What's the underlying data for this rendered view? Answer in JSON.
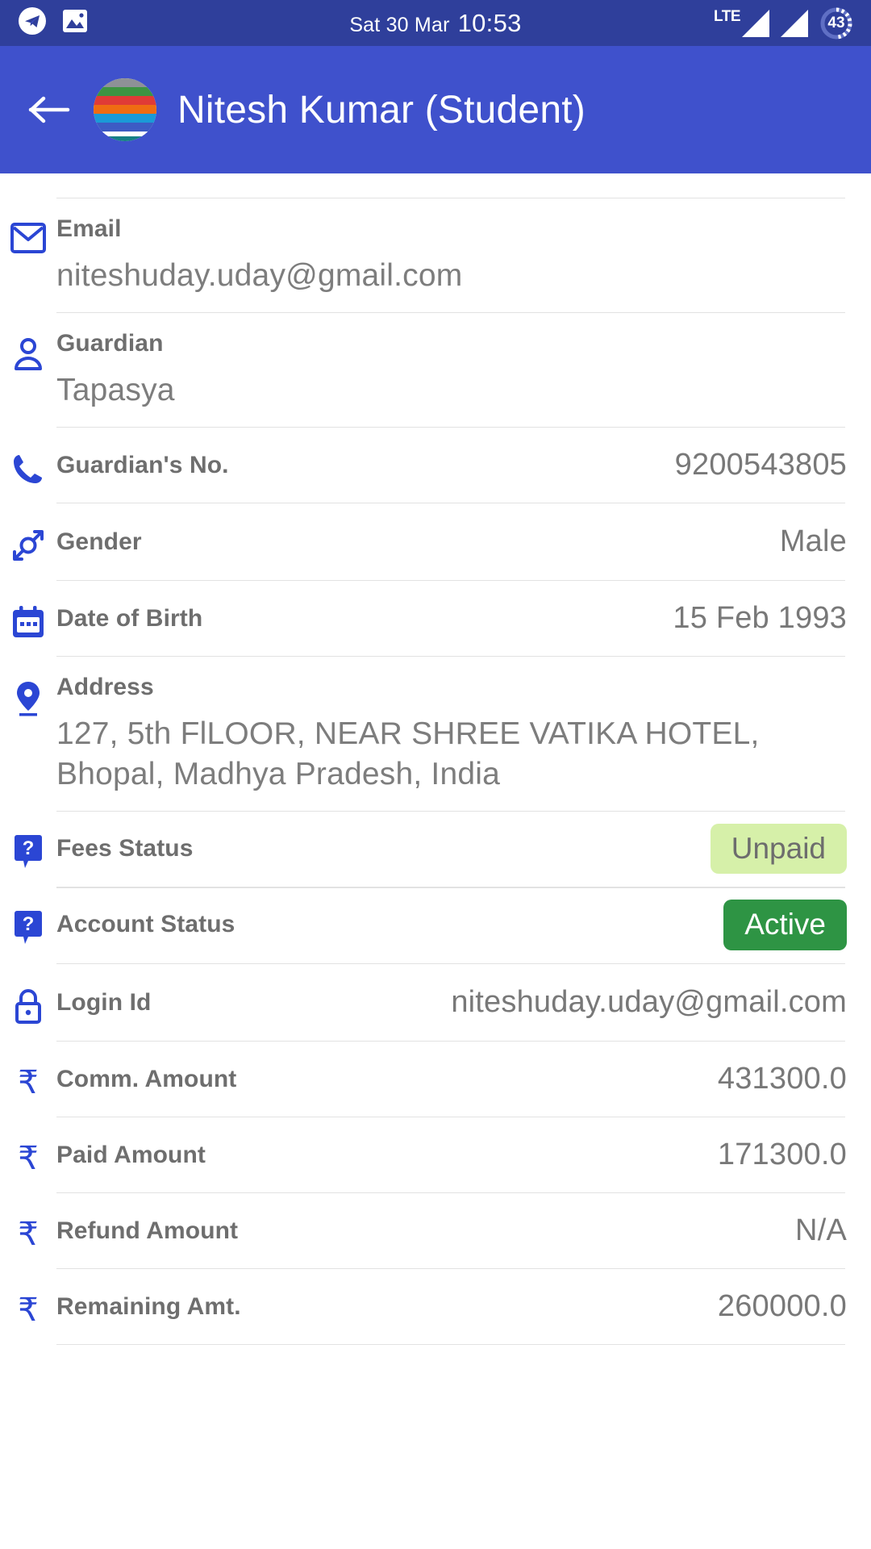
{
  "status_bar": {
    "notification_icons": [
      "telegram-icon",
      "screenshot-image-icon"
    ],
    "date": "Sat 30 Mar",
    "time": "10:53",
    "network_label": "LTE",
    "battery_percent": "43"
  },
  "app_bar": {
    "back_icon": "back-arrow-icon",
    "avatar_icon": "user-avatar",
    "title": "Nitesh Kumar (Student)"
  },
  "colors": {
    "status_bar_bg": "#2f3f9b",
    "app_bar_bg": "#3f51cc",
    "icon_blue": "#2b46d4",
    "label_gray": "#6e6e6e",
    "value_gray": "#787878",
    "divider": "#e2e2e2",
    "badge_unpaid_bg": "#d6f0a9",
    "badge_unpaid_text": "#6d6d6d",
    "badge_active_bg": "#2e9444",
    "badge_active_text": "#ffffff"
  },
  "details": [
    {
      "icon": "email-icon",
      "label": "Email",
      "value": "niteshuday.uday@gmail.com",
      "layout": "stack"
    },
    {
      "icon": "person-icon",
      "label": "Guardian",
      "value": "Tapasya",
      "layout": "stack"
    },
    {
      "icon": "phone-icon",
      "label": "Guardian's No.",
      "value": "9200543805",
      "layout": "single"
    },
    {
      "icon": "gender-icon",
      "label": "Gender",
      "value": "Male",
      "layout": "single"
    },
    {
      "icon": "calendar-icon",
      "label": "Date of Birth",
      "value": "15 Feb 1993",
      "layout": "single"
    },
    {
      "icon": "location-pin-icon",
      "label": "Address",
      "value": "127, 5th FlLOOR, NEAR SHREE VATIKA HOTEL, Bhopal, Madhya Pradesh, India",
      "layout": "stack"
    },
    {
      "icon": "question-mark-icon",
      "label": "Fees Status",
      "value": "Unpaid",
      "layout": "badge",
      "badge_style": "unpaid"
    },
    {
      "icon": "question-mark-icon",
      "label": "Account Status",
      "value": "Active",
      "layout": "badge",
      "badge_style": "active"
    },
    {
      "icon": "lock-icon",
      "label": "Login Id",
      "value": "niteshuday.uday@gmail.com",
      "layout": "single"
    },
    {
      "icon": "rupee-icon",
      "label": "Comm. Amount",
      "value": "431300.0",
      "layout": "single"
    },
    {
      "icon": "rupee-icon",
      "label": "Paid Amount",
      "value": "171300.0",
      "layout": "single"
    },
    {
      "icon": "rupee-icon",
      "label": "Refund Amount",
      "value": "N/A",
      "layout": "single"
    },
    {
      "icon": "rupee-icon",
      "label": "Remaining Amt.",
      "value": "260000.0",
      "layout": "single"
    }
  ]
}
